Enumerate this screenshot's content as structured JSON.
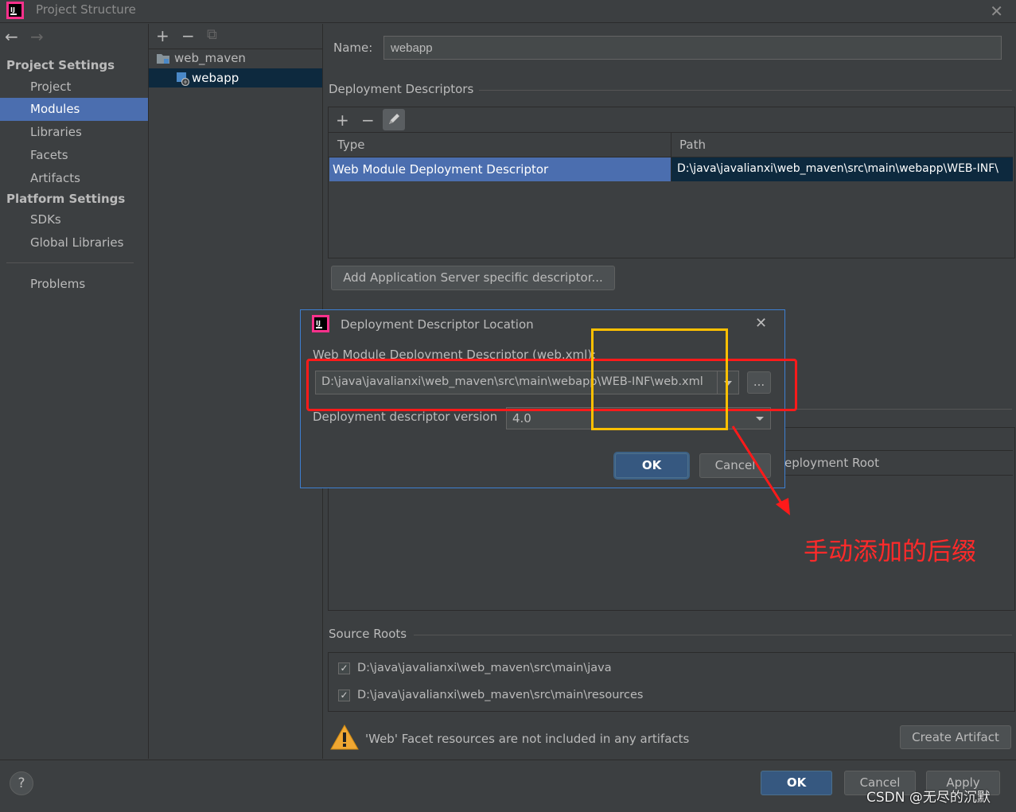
{
  "window": {
    "title": "Project Structure"
  },
  "sidebar": {
    "project_settings_header": "Project Settings",
    "platform_settings_header": "Platform Settings",
    "items": [
      {
        "label": "Project"
      },
      {
        "label": "Modules"
      },
      {
        "label": "Libraries"
      },
      {
        "label": "Facets"
      },
      {
        "label": "Artifacts"
      },
      {
        "label": "SDKs"
      },
      {
        "label": "Global Libraries"
      },
      {
        "label": "Problems"
      }
    ]
  },
  "tree": {
    "toolbar": {
      "add": "+",
      "remove": "−",
      "copy": "⧉"
    },
    "nodes": [
      {
        "label": "web_maven"
      },
      {
        "label": "webapp"
      }
    ]
  },
  "main": {
    "name_label": "Name:",
    "name_value": "webapp",
    "deployment_descriptors_title": "Deployment Descriptors",
    "dd_toolbar": {
      "add": "+",
      "remove": "−",
      "edit": "✎"
    },
    "dd_table": {
      "columns": [
        "Type",
        "Path"
      ],
      "rows": [
        {
          "type": "Web Module Deployment Descriptor",
          "path": "D:\\java\\javalianxi\\web_maven\\src\\main\\webapp\\WEB-INF\\"
        }
      ]
    },
    "add_server_descriptor_button": "Add Application Server specific descriptor...",
    "web_root_header_partial": "eployment Root",
    "source_roots_title": "Source Roots",
    "source_roots": [
      {
        "checked": true,
        "path": "D:\\java\\javalianxi\\web_maven\\src\\main\\java"
      },
      {
        "checked": true,
        "path": "D:\\java\\javalianxi\\web_maven\\src\\main\\resources"
      }
    ],
    "warning_text": "'Web' Facet resources are not included in any artifacts",
    "create_artifact_button": "Create Artifact"
  },
  "dialog": {
    "title": "Deployment Descriptor Location",
    "descriptor_label": "Web Module Deployment Descriptor (web.xml):",
    "descriptor_path": "D:\\java\\javalianxi\\web_maven\\src\\main\\webapp\\WEB-INF\\web.xml",
    "browse_label": "...",
    "version_label": "Deployment descriptor version",
    "version_value": "4.0",
    "ok_label": "OK",
    "cancel_label": "Cancel"
  },
  "annotation": {
    "text": "手动添加的后缀",
    "color": "#ff2a2a"
  },
  "footer": {
    "help": "?",
    "ok": "OK",
    "cancel": "Cancel",
    "apply": "Apply",
    "watermark": "CSDN @无尽的沉默"
  },
  "colors": {
    "selection": "#4b6eaf",
    "primary_button": "#365880",
    "dialog_border": "#3d7fd1",
    "red_highlight": "#ff1a1a",
    "yellow_highlight": "#ffc000"
  }
}
